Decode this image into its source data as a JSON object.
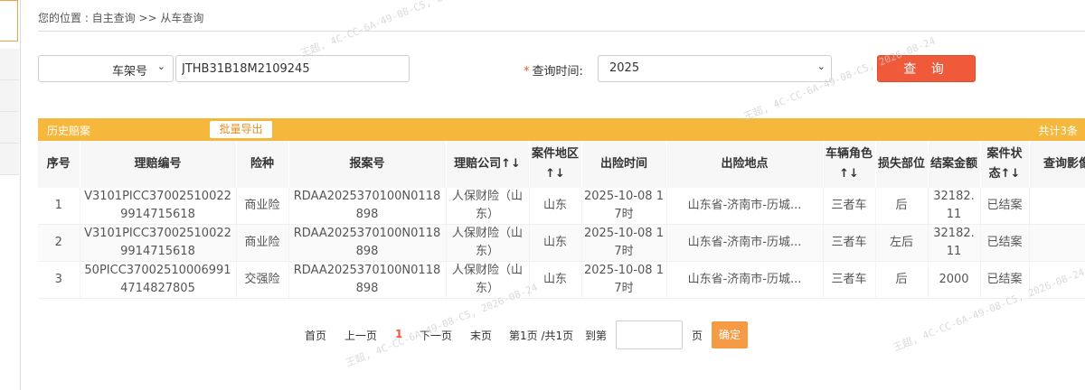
{
  "breadcrumb": "您的位置 : 自主查询 >> 从车查询",
  "search": {
    "field_type": "车架号",
    "vin_value": "JTHB31B18M2109245",
    "time_required_mark": "*",
    "time_label": "查询时间:",
    "time_value": "2025",
    "query_button": "查 询"
  },
  "section": {
    "title": "历史赔案",
    "export_button": "批量导出",
    "total": "共计3条"
  },
  "table": {
    "columns": [
      "序号",
      "理赔编号",
      "险种",
      "报案号",
      "理赔公司↑↓",
      "案件地区↑↓",
      "出险时间",
      "出险地点",
      "车辆角色↑↓",
      "损失部位",
      "结案金额",
      "案件状态↑↓",
      "查询影像"
    ],
    "rows": [
      {
        "no": "1",
        "claim_no": "V3101PICC370025100229914715618",
        "insurance": "商业险",
        "report_no": "RDAA2025370100N0118898",
        "company": "人保财险（山东）",
        "region": "山东",
        "time": "2025-10-08 17时",
        "location": "山东省-济南市-历城...",
        "role": "三者车",
        "part": "后",
        "amount": "32182.11",
        "status": "已结案",
        "image": ""
      },
      {
        "no": "2",
        "claim_no": "V3101PICC370025100229914715618",
        "insurance": "商业险",
        "report_no": "RDAA2025370100N0118898",
        "company": "人保财险（山东）",
        "region": "山东",
        "time": "2025-10-08 17时",
        "location": "山东省-济南市-历城...",
        "role": "三者车",
        "part": "左后",
        "amount": "32182.11",
        "status": "已结案",
        "image": ""
      },
      {
        "no": "3",
        "claim_no": "50PICC370025100069914714827805",
        "insurance": "交强险",
        "report_no": "RDAA2025370100N0118898",
        "company": "人保财险（山东）",
        "region": "山东",
        "time": "2025-10-08 17时",
        "location": "山东省-济南市-历城...",
        "role": "三者车",
        "part": "后",
        "amount": "2000",
        "status": "已结案",
        "image": ""
      }
    ]
  },
  "pager": {
    "first": "首页",
    "prev": "上一页",
    "current": "1",
    "next": "下一页",
    "last": "末页",
    "info": "第1页 /共1页",
    "goto_label": "到第",
    "page_unit": "页",
    "ok_button": "确定"
  },
  "watermark": "王超, 4C-CC-6A-49-08-C5, 2026-08-24"
}
